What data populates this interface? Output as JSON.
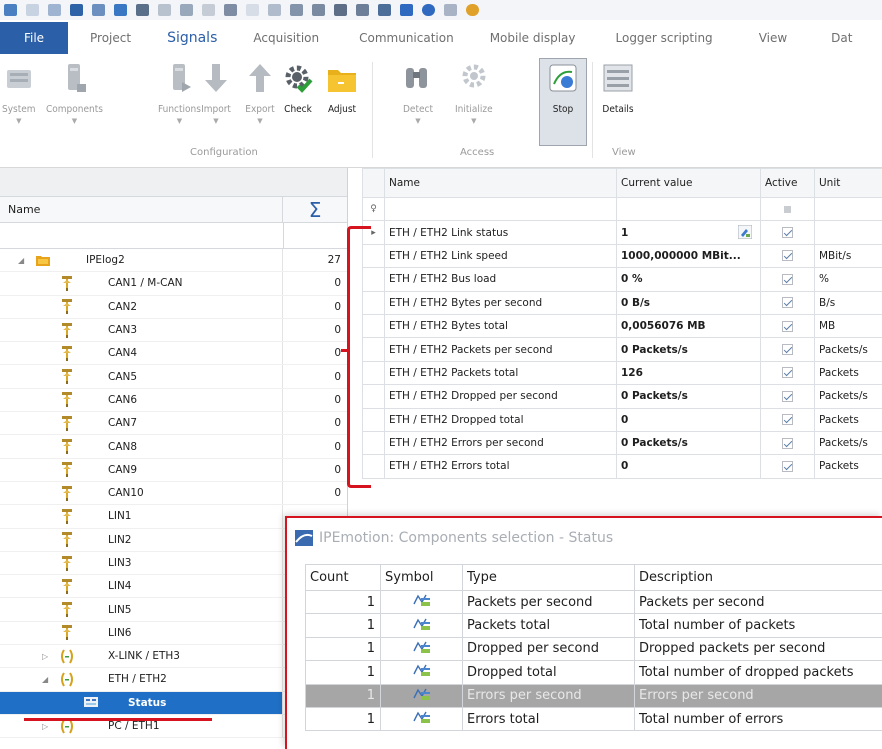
{
  "ribbon": {
    "tabs": [
      "File",
      "Project",
      "Signals",
      "Acquisition",
      "Communication",
      "Mobile display",
      "Logger scripting",
      "View",
      "Dat"
    ],
    "active_tab": "Signals",
    "buttons": {
      "system": "System",
      "components": "Components",
      "functions": "Functions",
      "import": "Import",
      "export": "Export",
      "check": "Check",
      "adjust": "Adjust",
      "detect": "Detect",
      "initialize": "Initialize",
      "stop": "Stop",
      "details": "Details"
    },
    "groups": {
      "configuration": "Configuration",
      "access": "Access",
      "view": "View"
    }
  },
  "tree": {
    "header_name": "Name",
    "header_sum": "Σ",
    "rows": [
      {
        "label": "IPElog2",
        "count": "27",
        "icon": "folder-icon",
        "expander": "◢"
      },
      {
        "label": "CAN1 / M-CAN",
        "count": "0",
        "icon": "pin-icon"
      },
      {
        "label": "CAN2",
        "count": "0",
        "icon": "pin-icon"
      },
      {
        "label": "CAN3",
        "count": "0",
        "icon": "pin-icon"
      },
      {
        "label": "CAN4",
        "count": "0",
        "icon": "pin-icon"
      },
      {
        "label": "CAN5",
        "count": "0",
        "icon": "pin-icon"
      },
      {
        "label": "CAN6",
        "count": "0",
        "icon": "pin-icon"
      },
      {
        "label": "CAN7",
        "count": "0",
        "icon": "pin-icon"
      },
      {
        "label": "CAN8",
        "count": "0",
        "icon": "pin-icon"
      },
      {
        "label": "CAN9",
        "count": "0",
        "icon": "pin-icon"
      },
      {
        "label": "CAN10",
        "count": "0",
        "icon": "pin-icon"
      },
      {
        "label": "LIN1",
        "count": "",
        "icon": "pin-icon"
      },
      {
        "label": "LIN2",
        "count": "",
        "icon": "pin-icon"
      },
      {
        "label": "LIN3",
        "count": "",
        "icon": "pin-icon"
      },
      {
        "label": "LIN4",
        "count": "",
        "icon": "pin-icon"
      },
      {
        "label": "LIN5",
        "count": "",
        "icon": "pin-icon"
      },
      {
        "label": "LIN6",
        "count": "",
        "icon": "pin-icon"
      },
      {
        "label": "X-LINK / ETH3",
        "count": "",
        "icon": "eth-icon",
        "expander": "▷"
      },
      {
        "label": "ETH / ETH2",
        "count": "",
        "icon": "eth-icon",
        "expander": "◢"
      },
      {
        "label": "Status",
        "count": "",
        "icon": "status-icon",
        "selected": true
      },
      {
        "label": "PC / ETH1",
        "count": "",
        "icon": "eth-icon",
        "expander": "▷"
      }
    ]
  },
  "grid": {
    "columns": [
      "Name",
      "Current value",
      "Active",
      "Unit"
    ],
    "filter_symbol": "♀",
    "rows": [
      {
        "name": "ETH / ETH2 Link status",
        "value": "1",
        "unit": "",
        "current": true
      },
      {
        "name": "ETH / ETH2 Link speed",
        "value": "1000,000000 MBit...",
        "unit": "MBit/s"
      },
      {
        "name": "ETH / ETH2 Bus load",
        "value": "0 %",
        "unit": "%"
      },
      {
        "name": "ETH / ETH2 Bytes per second",
        "value": "0 B/s",
        "unit": "B/s"
      },
      {
        "name": "ETH / ETH2 Bytes total",
        "value": "0,0056076 MB",
        "unit": "MB"
      },
      {
        "name": "ETH / ETH2 Packets per second",
        "value": "0 Packets/s",
        "unit": "Packets/s"
      },
      {
        "name": "ETH / ETH2 Packets total",
        "value": "126",
        "unit": "Packets"
      },
      {
        "name": "ETH / ETH2 Dropped per second",
        "value": "0 Packets/s",
        "unit": "Packets/s"
      },
      {
        "name": "ETH / ETH2 Dropped total",
        "value": "0",
        "unit": "Packets"
      },
      {
        "name": "ETH / ETH2 Errors per second",
        "value": "0 Packets/s",
        "unit": "Packets/s"
      },
      {
        "name": "ETH / ETH2 Errors total",
        "value": "0",
        "unit": "Packets"
      }
    ]
  },
  "popup": {
    "title": "IPEmotion: Components selection - Status",
    "columns": [
      "Count",
      "Symbol",
      "Type",
      "Description"
    ],
    "rows": [
      {
        "count": "1",
        "type": "Packets per second",
        "description": "Packets per second"
      },
      {
        "count": "1",
        "type": "Packets total",
        "description": "Total number of packets"
      },
      {
        "count": "1",
        "type": "Dropped per second",
        "description": "Dropped packets per second"
      },
      {
        "count": "1",
        "type": "Dropped total",
        "description": "Total number of dropped packets"
      },
      {
        "count": "1",
        "type": "Errors per second",
        "description": "Errors per second",
        "highlighted": true
      },
      {
        "count": "1",
        "type": "Errors total",
        "description": "Total number of errors"
      }
    ]
  },
  "colors": {
    "accent": "#2b5fa8",
    "annotation": "#d6141f",
    "selection": "#1f6fc6"
  }
}
